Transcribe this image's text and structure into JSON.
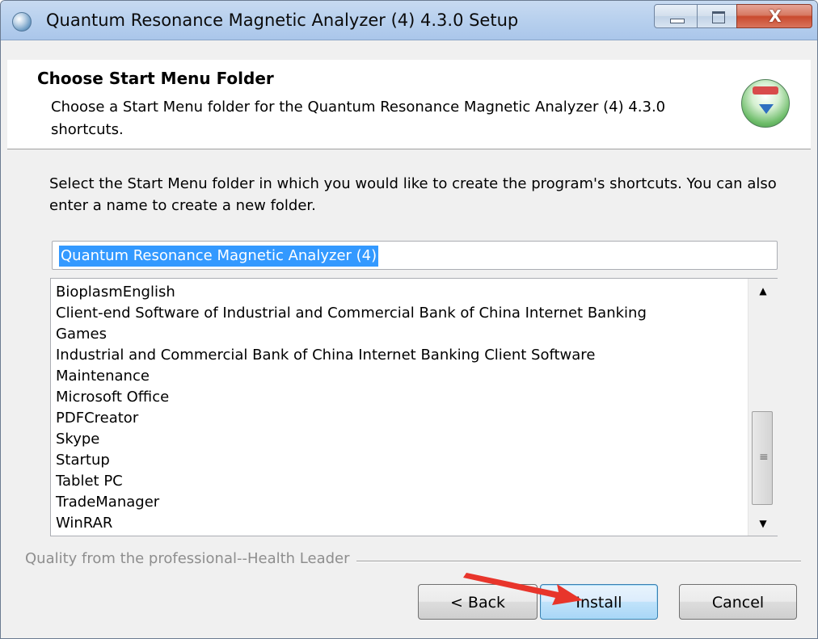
{
  "window": {
    "title": "Quantum Resonance Magnetic Analyzer (4) 4.3.0 Setup",
    "close_glyph": "X"
  },
  "header": {
    "title": "Choose Start Menu Folder",
    "subtitle": "Choose a Start Menu folder for the Quantum Resonance Magnetic Analyzer (4) 4.3.0 shortcuts."
  },
  "instructions": "Select the Start Menu folder in which you would like to create the program's shortcuts. You can also enter a name to create a new folder.",
  "folder_input": {
    "value": "Quantum Resonance Magnetic Analyzer (4)"
  },
  "folder_list": {
    "items": [
      "BioplasmEnglish",
      "Client-end Software of Industrial and Commercial Bank of China Internet Banking",
      "Games",
      "Industrial and Commercial Bank of China Internet Banking Client Software",
      "Maintenance",
      "Microsoft Office",
      "PDFCreator",
      "Skype",
      "Startup",
      "Tablet PC",
      "TradeManager",
      "WinRAR"
    ]
  },
  "scrollbar": {
    "up_glyph": "▲",
    "down_glyph": "▼",
    "grip_glyph": "≡"
  },
  "branding": "Quality from the professional--Health Leader",
  "buttons": {
    "back": "< Back",
    "install": "Install",
    "cancel": "Cancel"
  },
  "colors": {
    "selection": "#3399ff",
    "annotation_arrow": "#e8352b"
  }
}
